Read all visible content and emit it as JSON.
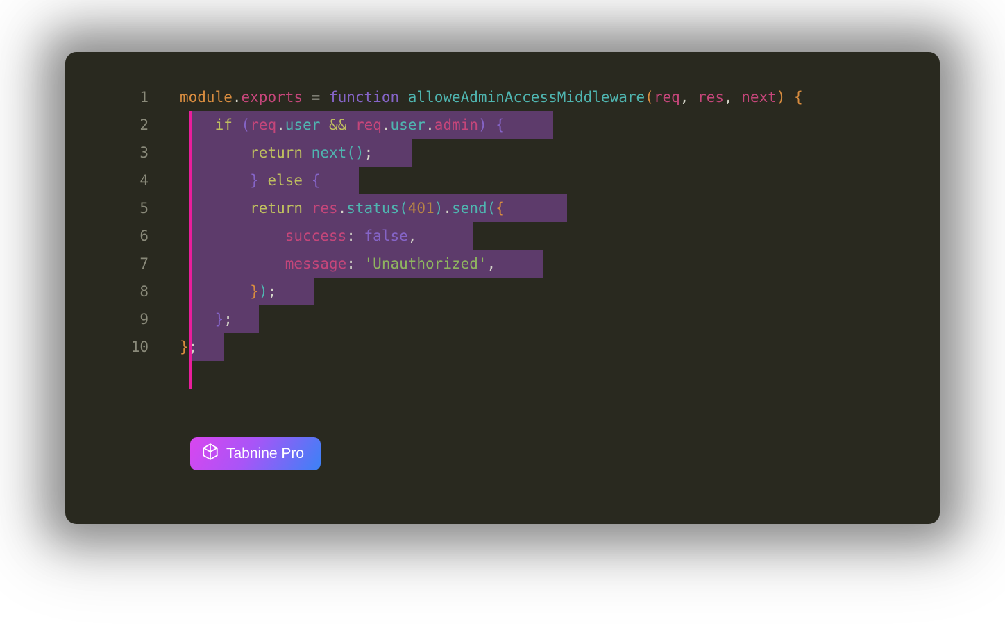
{
  "lineNumbers": [
    "1",
    "2",
    "3",
    "4",
    "5",
    "6",
    "7",
    "8",
    "9",
    "10"
  ],
  "code": {
    "l1": {
      "module": "module",
      "dot1": ".",
      "exports": "exports",
      "eq": " = ",
      "function": "function",
      "sp1": " ",
      "fname": "alloweAdminAccessMiddleware",
      "po": "(",
      "req": "req",
      "c1": ", ",
      "res": "res",
      "c2": ", ",
      "next": "next",
      "pc": ")",
      "sp2": " ",
      "bo": "{"
    },
    "l2": {
      "indent": "    ",
      "if": "if",
      "sp": " ",
      "po": "(",
      "req1": "req",
      "d1": ".",
      "user1": "user",
      "and": " && ",
      "req2": "req",
      "d2": ".",
      "user2": "user",
      "d3": ".",
      "admin": "admin",
      "pc": ")",
      "sp2": " ",
      "bo": "{"
    },
    "l3": {
      "indent": "        ",
      "return": "return",
      "sp": " ",
      "next": "next",
      "po": "(",
      "pc": ")",
      "semi": ";"
    },
    "l4": {
      "indent": "        ",
      "bc": "}",
      "sp": " ",
      "else": "else",
      "sp2": " ",
      "bo": "{"
    },
    "l5": {
      "indent": "        ",
      "return": "return",
      "sp": " ",
      "res": "res",
      "d1": ".",
      "status": "status",
      "po1": "(",
      "num": "401",
      "pc1": ")",
      "d2": ".",
      "send": "send",
      "po2": "(",
      "bo": "{"
    },
    "l6": {
      "indent": "            ",
      "key": "success",
      "colon": ": ",
      "val": "false",
      "comma": ","
    },
    "l7": {
      "indent": "            ",
      "key": "message",
      "colon": ": ",
      "val": "'Unauthorized'",
      "comma": ","
    },
    "l8": {
      "indent": "        ",
      "bc": "}",
      "pc": ")",
      "semi": ";"
    },
    "l9": {
      "indent": "    ",
      "bc": "}",
      "semi": ";"
    },
    "l10": {
      "bc": "}",
      "semi": ";"
    }
  },
  "badge": {
    "label": "Tabnine Pro"
  }
}
